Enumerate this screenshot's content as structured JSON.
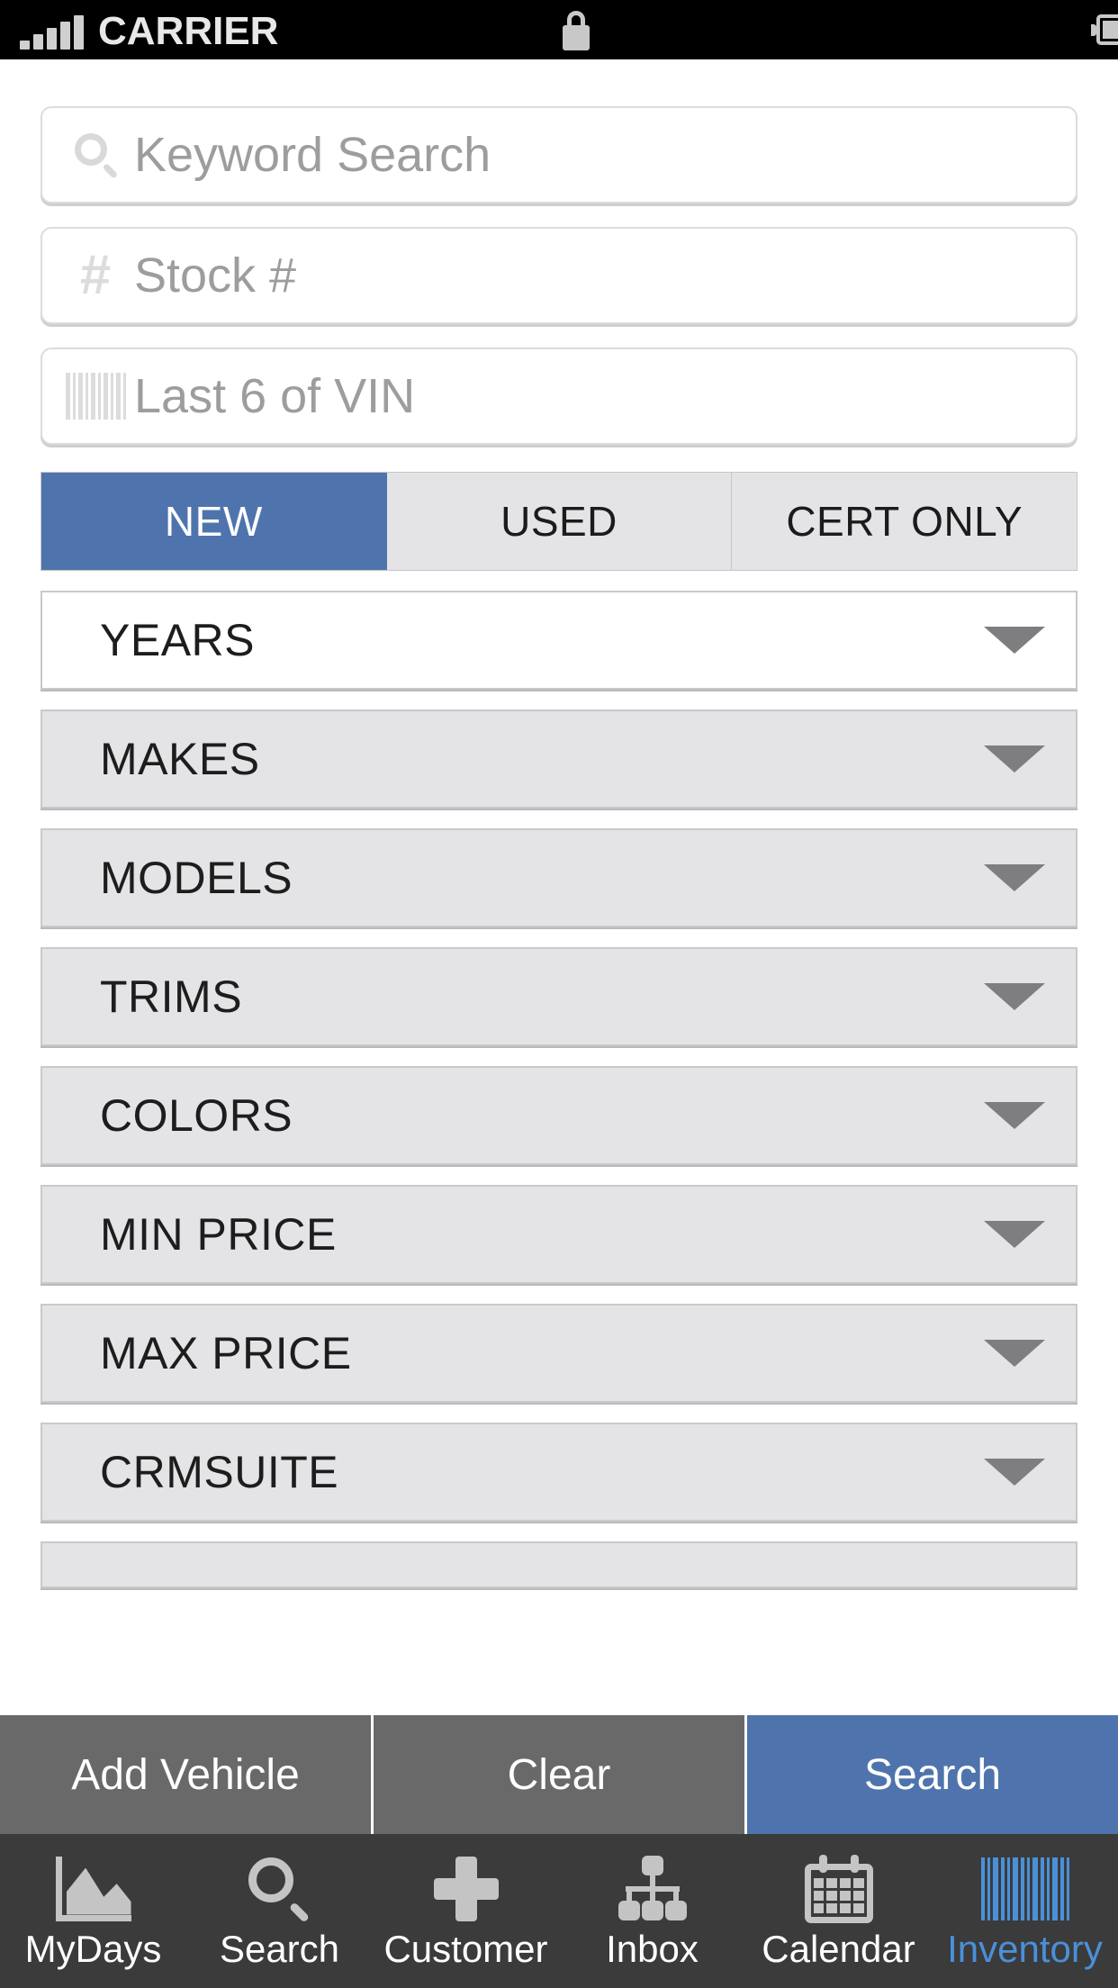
{
  "statusbar": {
    "carrier": "CARRIER",
    "signal_icon": "signal-bars-icon",
    "lock_icon": "lock-icon",
    "battery_icon": "battery-icon"
  },
  "search_fields": [
    {
      "icon": "search-icon",
      "placeholder": "Keyword Search",
      "value": ""
    },
    {
      "icon": "hash-icon",
      "placeholder": "Stock #",
      "value": ""
    },
    {
      "icon": "barcode-icon",
      "placeholder": "Last 6 of VIN",
      "value": ""
    }
  ],
  "condition_segments": [
    {
      "label": "NEW",
      "selected": true
    },
    {
      "label": "USED",
      "selected": false
    },
    {
      "label": "CERT ONLY",
      "selected": false
    }
  ],
  "filters": [
    {
      "label": "YEARS",
      "expanded": true,
      "caret": "chevron-down-icon"
    },
    {
      "label": "MAKES",
      "expanded": false,
      "caret": "chevron-down-icon"
    },
    {
      "label": "MODELS",
      "expanded": false,
      "caret": "chevron-down-icon"
    },
    {
      "label": "TRIMS",
      "expanded": false,
      "caret": "chevron-down-icon"
    },
    {
      "label": "COLORS",
      "expanded": false,
      "caret": "chevron-down-icon"
    },
    {
      "label": "MIN PRICE",
      "expanded": false,
      "caret": "chevron-down-icon"
    },
    {
      "label": "MAX PRICE",
      "expanded": false,
      "caret": "chevron-down-icon"
    },
    {
      "label": "CRMSUITE",
      "expanded": false,
      "caret": "chevron-down-icon"
    }
  ],
  "action_bar": [
    {
      "label": "Add Vehicle",
      "primary": false
    },
    {
      "label": "Clear",
      "primary": false
    },
    {
      "label": "Search",
      "primary": true
    }
  ],
  "tabs": [
    {
      "label": "MyDays",
      "icon": "chart-icon",
      "active": false
    },
    {
      "label": "Search",
      "icon": "search-icon",
      "active": false
    },
    {
      "label": "Customer",
      "icon": "plus-icon",
      "active": false
    },
    {
      "label": "Inbox",
      "icon": "hierarchy-icon",
      "active": false
    },
    {
      "label": "Calendar",
      "icon": "calendar-icon",
      "active": false
    },
    {
      "label": "Inventory",
      "icon": "barcode-icon",
      "active": true
    }
  ],
  "colors": {
    "accent_blue": "#4f74ad",
    "active_tab_blue": "#4a90d9",
    "row_gray": "#e4e4e6",
    "action_bar_gray": "#696969",
    "tab_bar_gray": "#3b3b3b"
  }
}
